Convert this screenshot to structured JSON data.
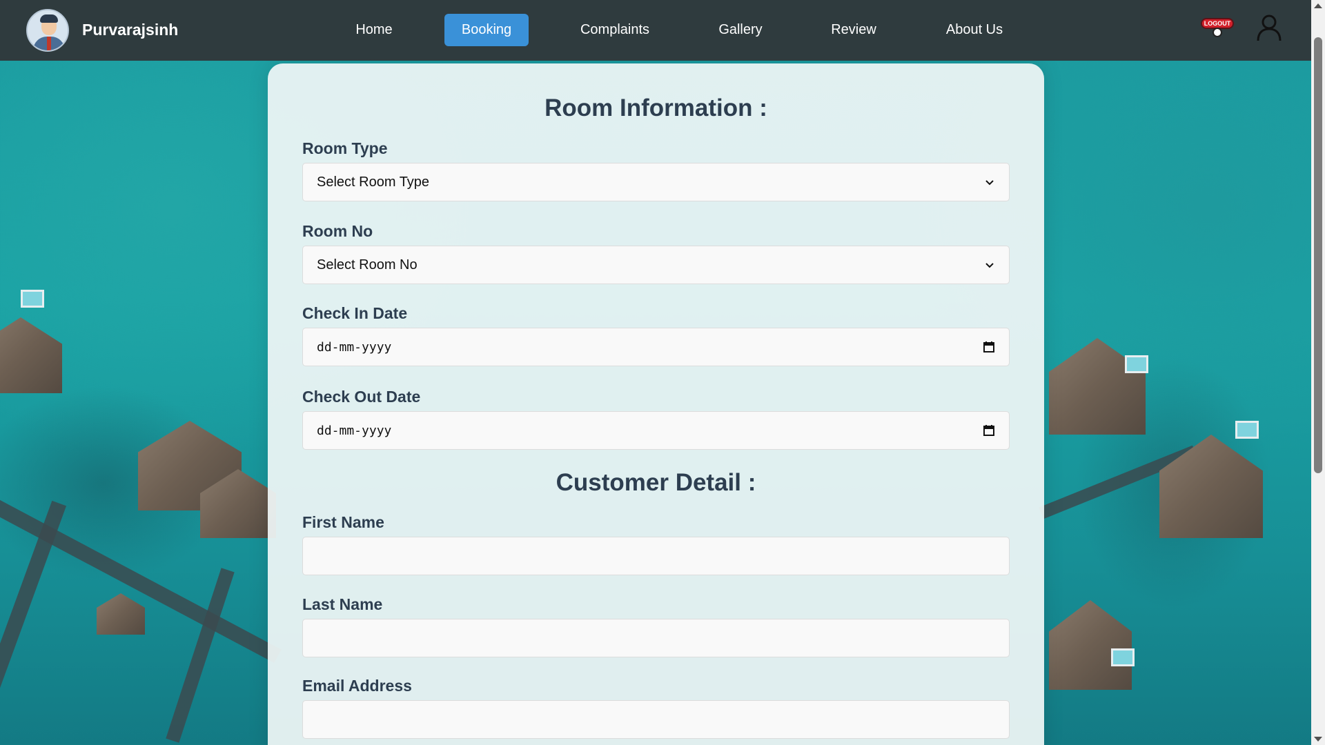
{
  "navbar": {
    "brand": "Purvarajsinh",
    "links": [
      "Home",
      "Booking",
      "Complaints",
      "Gallery",
      "Review",
      "About Us"
    ],
    "active_link": "Booking",
    "logout_badge": "LOGOUT",
    "icons": [
      "avatar",
      "logout-icon",
      "user-icon"
    ]
  },
  "form": {
    "room_section_title": "Room Information :",
    "room_type": {
      "label": "Room Type",
      "selected": "Select Room Type"
    },
    "room_no": {
      "label": "Room No",
      "selected": "Select Room No"
    },
    "check_in": {
      "label": "Check In Date",
      "placeholder": "dd-mm-yyyy"
    },
    "check_out": {
      "label": "Check Out Date",
      "placeholder": "dd-mm-yyyy"
    },
    "customer_section_title": "Customer Detail :",
    "first_name": {
      "label": "First Name",
      "value": ""
    },
    "last_name": {
      "label": "Last Name",
      "value": ""
    },
    "email": {
      "label": "Email Address",
      "value": ""
    }
  },
  "colors": {
    "navbar_bg": "#2f3b3e",
    "active_tab": "#3a91d8",
    "heading_text": "#2d3e50",
    "water": "#1b9aa0"
  }
}
